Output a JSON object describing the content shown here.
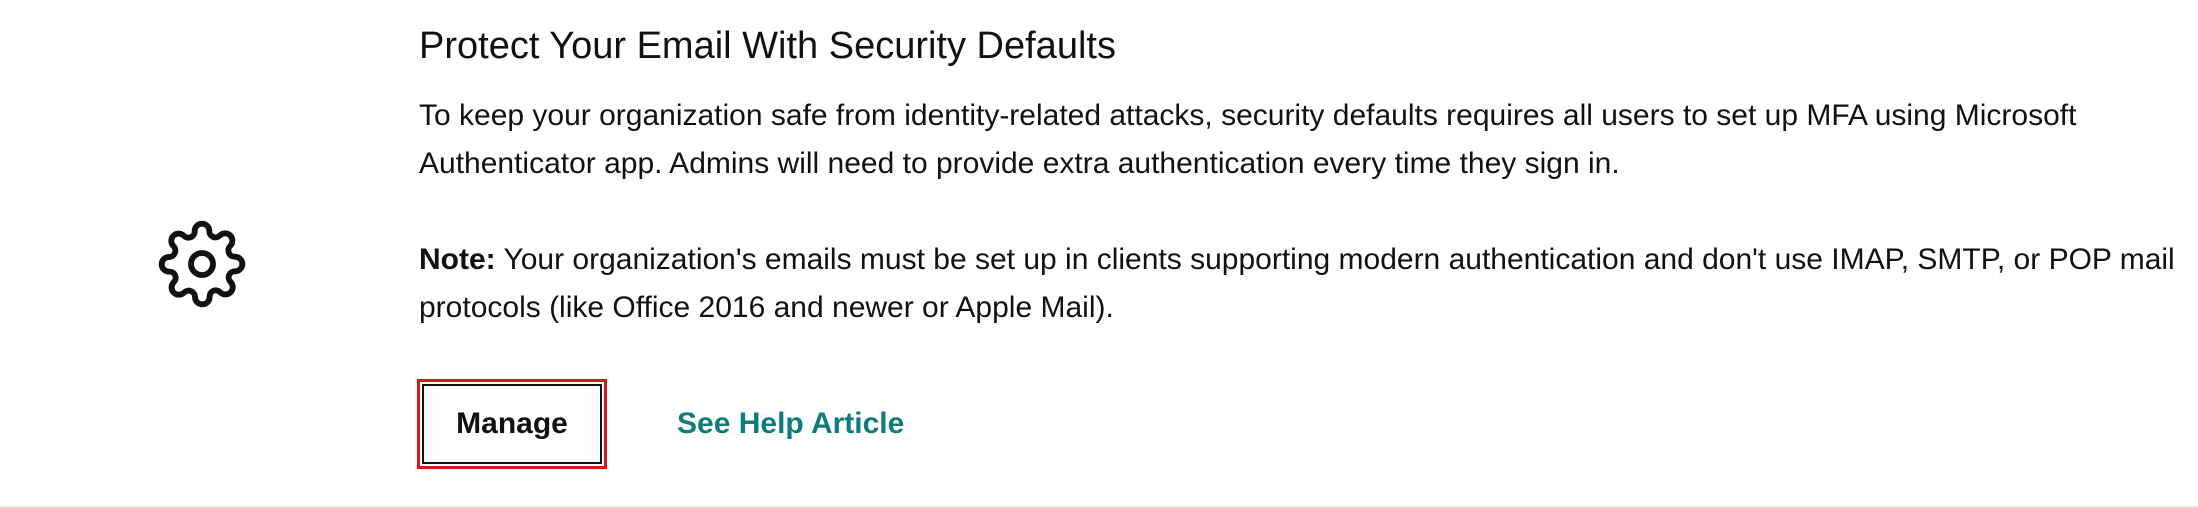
{
  "section": {
    "title": "Protect Your Email With Security Defaults",
    "description": "To keep your organization safe from identity-related attacks, security defaults requires all users to set up MFA using Microsoft Authenticator app. Admins will need to provide extra authentication every time they sign in.",
    "note_label": "Note:",
    "note_text": " Your organization's emails must be set up in clients supporting modern authentication and don't use IMAP, SMTP, or POP mail protocols (like Office 2016 and newer or Apple Mail).",
    "icon": "gear-icon"
  },
  "actions": {
    "manage_label": "Manage",
    "help_link_label": "See Help Article"
  },
  "colors": {
    "link": "#0e7c7b",
    "focus_border": "#d21a1a",
    "text": "#111111"
  }
}
